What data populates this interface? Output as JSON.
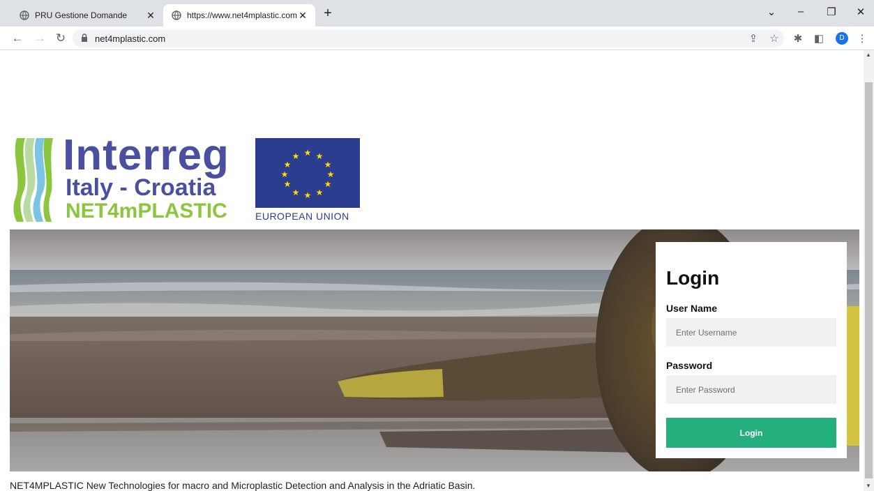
{
  "browser": {
    "tabs": [
      {
        "title": "PRU Gestione Domande",
        "active": false
      },
      {
        "title": "https://www.net4mplastic.com",
        "active": true
      }
    ],
    "address_url": "net4mplastic.com",
    "profile_initial": "D"
  },
  "logo": {
    "line1": "Interreg",
    "line2": "Italy - Croatia",
    "line3": "NET4mPLASTIC",
    "eu_label": "EUROPEAN UNION"
  },
  "login": {
    "title": "Login",
    "username_label": "User Name",
    "username_placeholder": "Enter Username",
    "password_label": "Password",
    "password_placeholder": "Enter Password",
    "button_label": "Login"
  },
  "footer": {
    "description": "NET4MPLASTIC New Technologies for macro and Microplastic Detection and Analysis in the Adriatic Basin."
  },
  "colors": {
    "interreg_blue": "#4a4fa0",
    "plastic_green": "#8cc63f",
    "eu_blue": "#2a3d8f",
    "eu_star": "#ffdd00",
    "login_button": "#23b07d"
  }
}
